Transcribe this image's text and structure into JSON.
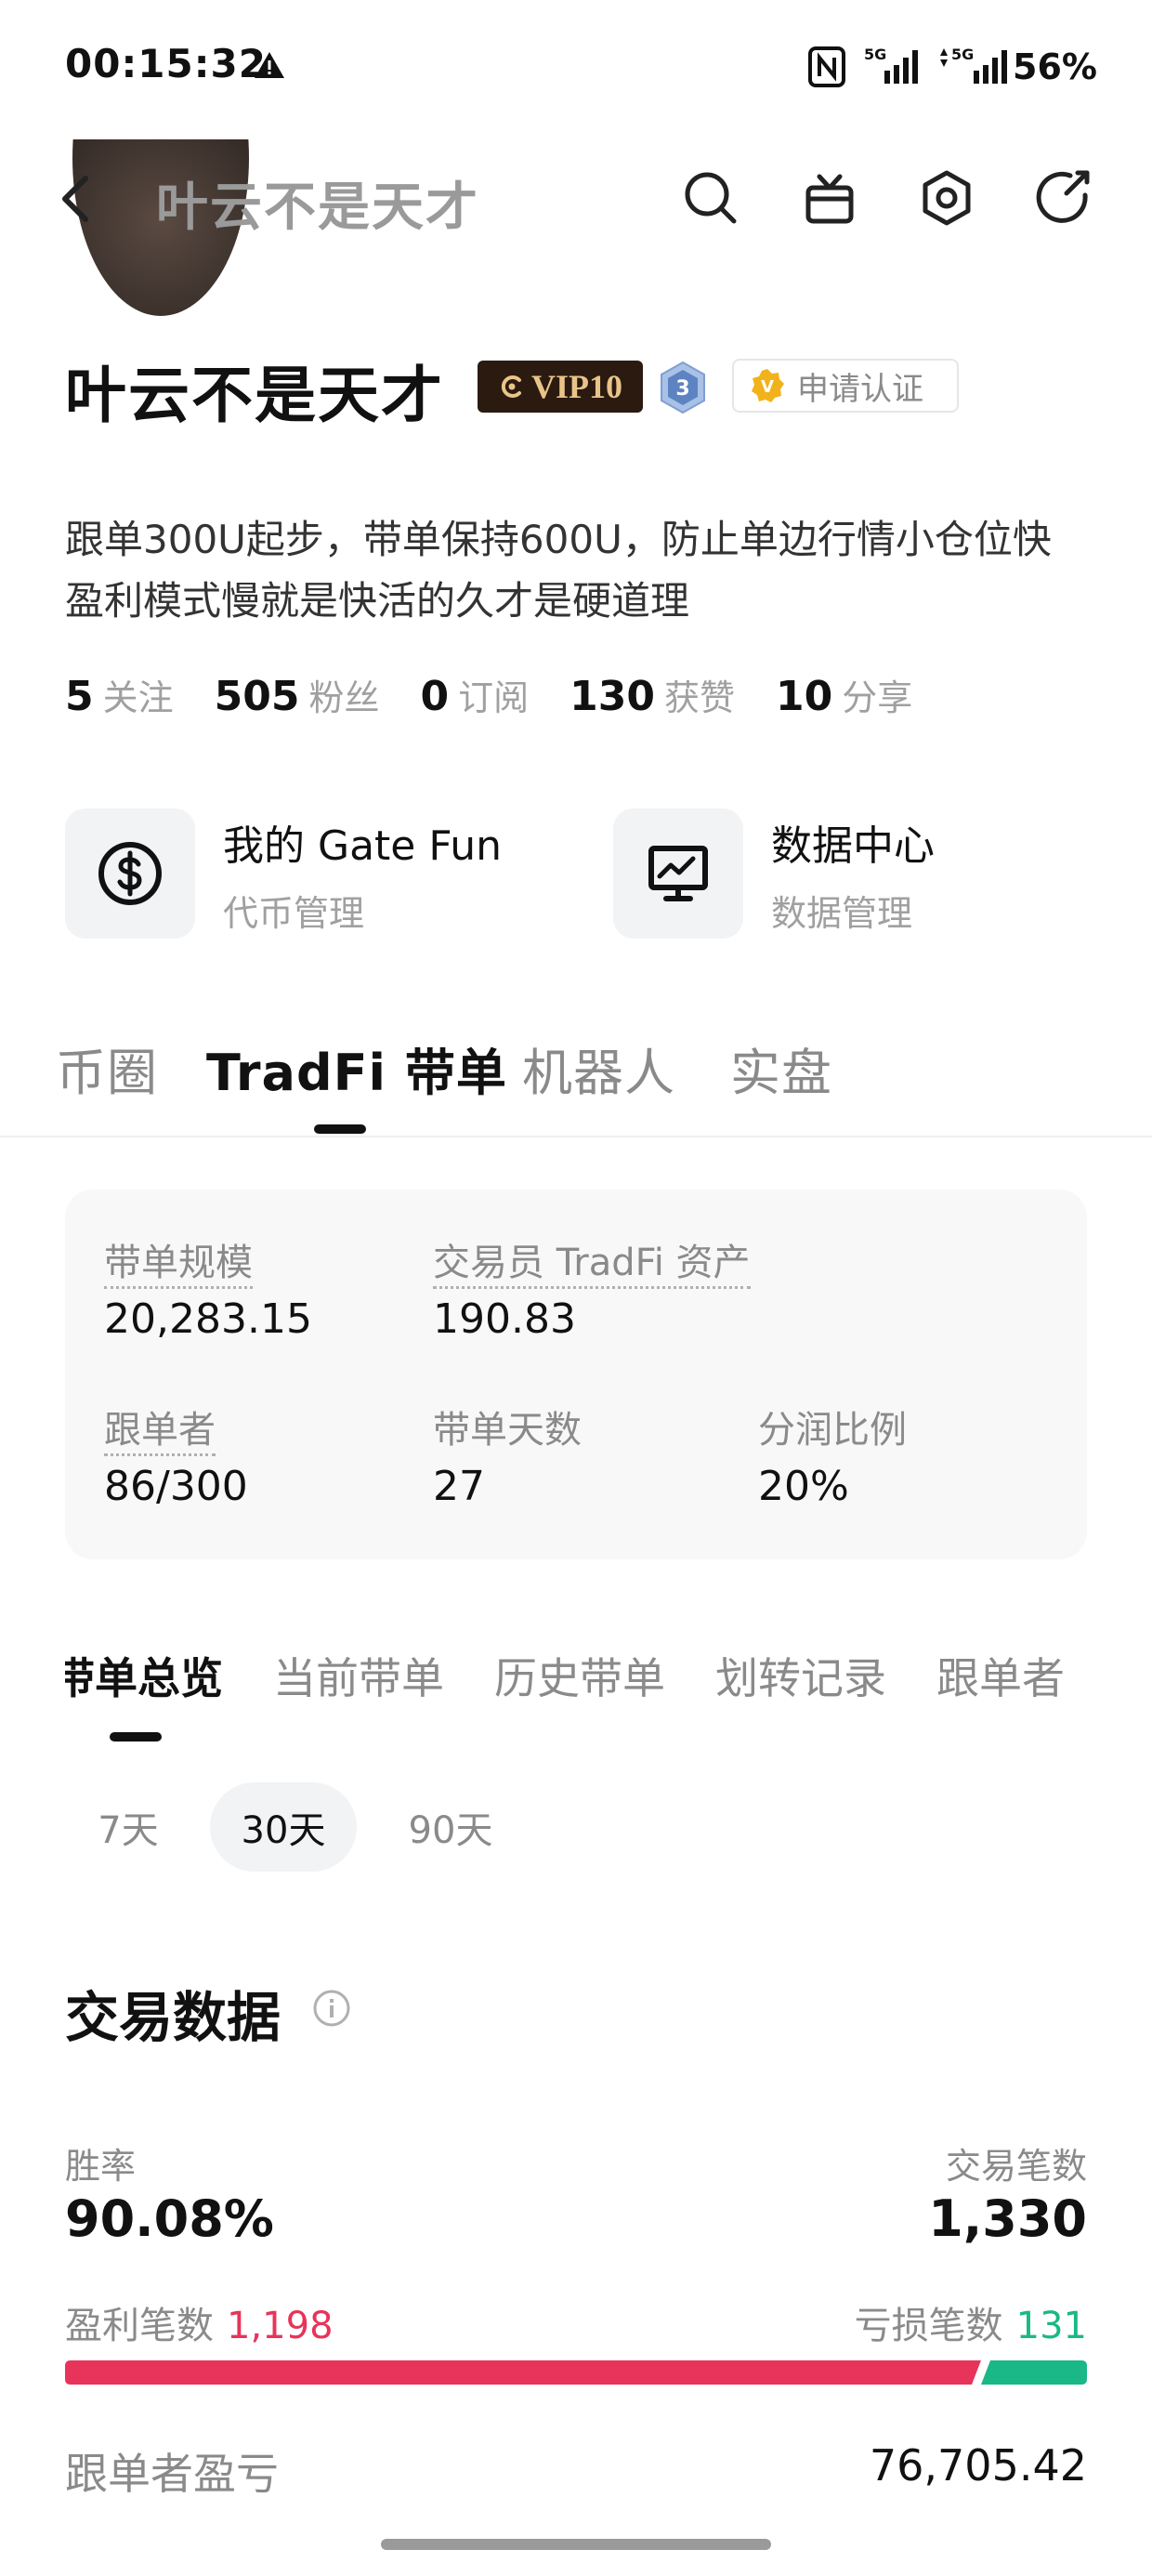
{
  "status_bar": {
    "time": "00:15:32",
    "network1": "5G",
    "network2": "5G",
    "battery": "56%"
  },
  "header": {
    "title": "叶云不是天才",
    "icons": [
      "back-icon",
      "search-icon",
      "gift-icon",
      "settings-icon",
      "share-icon"
    ]
  },
  "profile": {
    "name": "叶云不是天才",
    "vip_label": "VIP10",
    "level": "3",
    "verify_label": "申请认证",
    "bio": "跟单300U起步，带单保持600U，防止单边行情小仓位快盈利模式慢就是快活的久才是硬道理",
    "stats": [
      {
        "value": "5",
        "label": "关注"
      },
      {
        "value": "505",
        "label": "粉丝"
      },
      {
        "value": "0",
        "label": "订阅"
      },
      {
        "value": "130",
        "label": "获赞"
      },
      {
        "value": "10",
        "label": "分享"
      }
    ]
  },
  "cards": [
    {
      "title": "我的 Gate Fun",
      "subtitle": "代币管理",
      "icon": "dollar-circle-icon"
    },
    {
      "title": "数据中心",
      "subtitle": "数据管理",
      "icon": "chart-monitor-icon"
    }
  ],
  "main_tabs": [
    "币圈",
    "TradFi 带单",
    "机器人",
    "实盘"
  ],
  "main_tab_active": "TradFi 带单",
  "summary": {
    "scale_label": "带单规模",
    "scale_value": "20,283.15",
    "assets_label": "交易员 TradFi 资产",
    "assets_value": "190.83",
    "followers_label": "跟单者",
    "followers_value": "86/300",
    "days_label": "带单天数",
    "days_value": "27",
    "share_label": "分润比例",
    "share_value": "20%"
  },
  "sub_tabs": [
    "带单总览",
    "当前带单",
    "历史带单",
    "划转记录",
    "跟单者"
  ],
  "sub_tab_active": "带单总览",
  "periods": [
    "7天",
    "30天",
    "90天"
  ],
  "period_active": "30天",
  "trading": {
    "title": "交易数据",
    "win_rate_label": "胜率",
    "win_rate_value": "90.08%",
    "trades_label": "交易笔数",
    "trades_value": "1,330",
    "profit_label": "盈利笔数",
    "profit_value": "1,198",
    "loss_label": "亏损笔数",
    "loss_value": "131",
    "profit_ratio": 0.9008,
    "follower_pnl_label": "跟单者盈亏",
    "follower_pnl_value": "76,705.42"
  },
  "colors": {
    "profit": "#e8345a",
    "loss": "#1ab886",
    "vip_bg": "#2a1a10",
    "vip_text": "#e9c489"
  }
}
